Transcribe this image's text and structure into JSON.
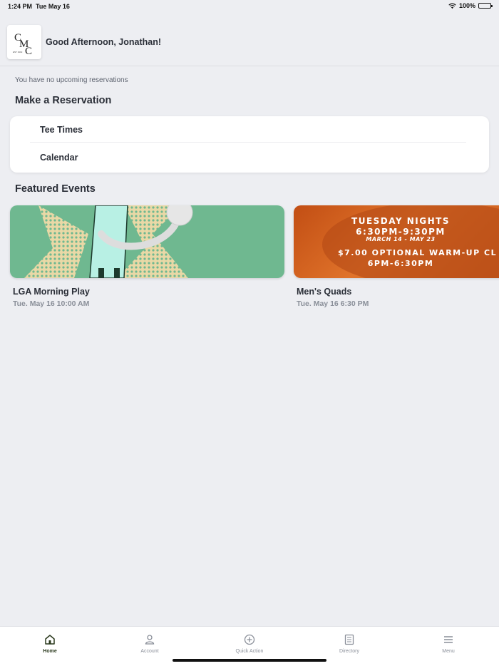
{
  "status_bar": {
    "time": "1:24 PM",
    "date": "Tue May 16",
    "battery": "100%"
  },
  "header": {
    "logo_text": "CMC",
    "logo_est": "EST 1919",
    "greeting": "Good Afternoon, Jonathan!"
  },
  "reservations": {
    "empty_message": "You have no upcoming reservations",
    "section_title": "Make a Reservation",
    "items": [
      {
        "label": "Tee Times"
      },
      {
        "label": "Calendar"
      }
    ]
  },
  "featured": {
    "section_title": "Featured Events",
    "events": [
      {
        "title": "LGA Morning Play",
        "datetime": "Tue. May 16 10:00 AM"
      },
      {
        "title": "Men's Quads",
        "datetime": "Tue. May 16 6:30 PM",
        "promo": {
          "line1": "TUESDAY NIGHTS",
          "line2": "6:30PM-9:30PM",
          "line3": "MARCH 14 - MAY 23",
          "line4": "$7.00 OPTIONAL WARM-UP CL",
          "line5": "6PM-6:30PM"
        }
      }
    ]
  },
  "tab_bar": {
    "tabs": [
      {
        "label": "Home",
        "icon": "home-icon",
        "active": true
      },
      {
        "label": "Account",
        "icon": "person-icon"
      },
      {
        "label": "Quick Action",
        "icon": "plus-circle-icon"
      },
      {
        "label": "Directory",
        "icon": "directory-icon"
      },
      {
        "label": "Menu",
        "icon": "hamburger-icon"
      }
    ]
  },
  "colors": {
    "background": "#edeef2",
    "accent_green": "#6fb890",
    "active_tab": "#2b3a1e"
  }
}
